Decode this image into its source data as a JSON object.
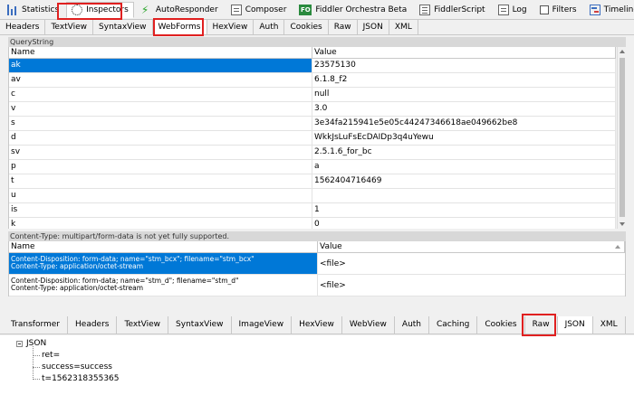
{
  "tool_tabs": [
    {
      "label": "Statistics",
      "icon": "statistics-icon"
    },
    {
      "label": "Inspectors",
      "icon": "inspectors-icon",
      "active": true
    },
    {
      "label": "AutoResponder",
      "icon": "lightning-icon"
    },
    {
      "label": "Composer",
      "icon": "composer-icon"
    },
    {
      "label": "Fiddler Orchestra Beta",
      "icon": "fo-icon",
      "icon_text": "FO"
    },
    {
      "label": "FiddlerScript",
      "icon": "script-icon"
    },
    {
      "label": "Log",
      "icon": "log-icon"
    },
    {
      "label": "Filters",
      "icon": "checkbox-icon"
    },
    {
      "label": "Timeline",
      "icon": "timeline-icon"
    }
  ],
  "request_tabs": [
    "Headers",
    "TextView",
    "SyntaxView",
    "WebForms",
    "HexView",
    "Auth",
    "Cookies",
    "Raw",
    "JSON",
    "XML"
  ],
  "request_active_tab": "WebForms",
  "querystring": {
    "title": "QueryString",
    "col_name": "Name",
    "col_value": "Value",
    "rows": [
      {
        "name": "ak",
        "value": "23575130"
      },
      {
        "name": "av",
        "value": "6.1.8_f2"
      },
      {
        "name": "c",
        "value": "null"
      },
      {
        "name": "v",
        "value": "3.0"
      },
      {
        "name": "s",
        "value": "3e34fa215941e5e05c44247346618ae049662be8"
      },
      {
        "name": "d",
        "value": "WkkJsLuFsEcDAIDp3q4uYewu"
      },
      {
        "name": "sv",
        "value": "2.5.1.6_for_bc"
      },
      {
        "name": "p",
        "value": "a"
      },
      {
        "name": "t",
        "value": "1562404716469"
      },
      {
        "name": "u",
        "value": ""
      },
      {
        "name": "is",
        "value": "1"
      },
      {
        "name": "k",
        "value": "0"
      }
    ]
  },
  "multipart": {
    "title": "Content-Type: multipart/form-data is not yet fully supported.",
    "col_name": "Name",
    "col_value": "Value",
    "rows": [
      {
        "line1": "Content-Disposition: form-data; name=\"stm_bcx\"; filename=\"stm_bcx\"",
        "line2": "Content-Type: application/octet-stream",
        "value": "<file>"
      },
      {
        "line1": "Content-Disposition: form-data; name=\"stm_d\"; filename=\"stm_d\"",
        "line2": "Content-Type: application/octet-stream",
        "value": "<file>"
      }
    ]
  },
  "response_tabs": [
    "Transformer",
    "Headers",
    "TextView",
    "SyntaxView",
    "ImageView",
    "HexView",
    "WebView",
    "Auth",
    "Caching",
    "Cookies",
    "Raw",
    "JSON",
    "XML"
  ],
  "response_active_tab": "JSON",
  "json_tree": {
    "root": "JSON",
    "children": [
      "ret=",
      "success=success",
      "t=1562318355365"
    ]
  },
  "colors": {
    "selection": "#0078d7",
    "highlight_box": "#e02020"
  }
}
